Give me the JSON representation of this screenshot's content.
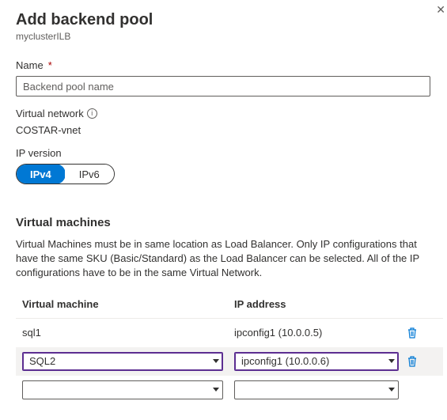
{
  "header": {
    "title": "Add backend pool",
    "subtitle": "myclusterILB"
  },
  "name_field": {
    "label": "Name",
    "placeholder": "Backend pool name"
  },
  "vnet": {
    "label": "Virtual network",
    "value": "COSTAR-vnet"
  },
  "ipver": {
    "label": "IP version",
    "opt1": "IPv4",
    "opt2": "IPv6"
  },
  "vm_section": {
    "heading": "Virtual machines",
    "help": "Virtual Machines must be in same location as Load Balancer. Only IP configurations that have the same SKU (Basic/Standard) as the Load Balancer can be selected. All of the IP configurations have to be in the same Virtual Network.",
    "col_vm": "Virtual machine",
    "col_ip": "IP address",
    "rows": [
      {
        "vm": "sql1",
        "ip": "ipconfig1 (10.0.0.5)"
      },
      {
        "vm": "SQL2",
        "ip": "ipconfig1 (10.0.0.6)"
      },
      {
        "vm": "",
        "ip": ""
      }
    ]
  }
}
